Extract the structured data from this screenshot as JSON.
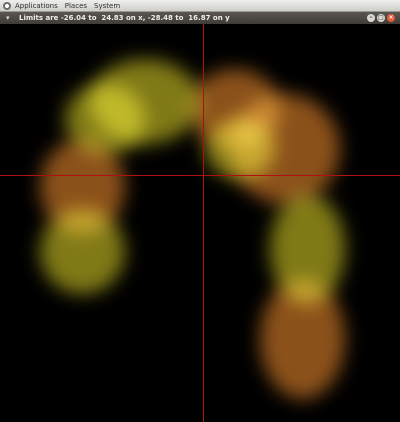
{
  "top_panel": {
    "menus": [
      "Applications",
      "Places",
      "System"
    ]
  },
  "window": {
    "title": "Limits are -26.04 to  24.83 on x, -28.48 to  16.87 on y",
    "buttons": [
      "minimize",
      "maximize",
      "close"
    ]
  },
  "plot": {
    "background": "#000000",
    "crosshair_color": "#b01010",
    "point_colors": [
      "#e8dc28",
      "#f08c2d"
    ]
  }
}
